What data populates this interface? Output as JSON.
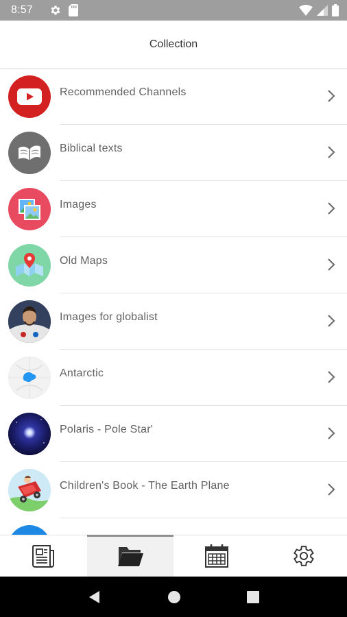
{
  "status_bar": {
    "time": "8:57",
    "left_icons": [
      "gear-icon",
      "sd-card-icon"
    ],
    "right_icons": [
      "wifi-icon",
      "signal-icon",
      "battery-icon"
    ]
  },
  "header": {
    "title": "Collection"
  },
  "collection": {
    "items": [
      {
        "label": "Recommended Channels",
        "icon": "youtube-icon",
        "color": "#d32020"
      },
      {
        "label": "Biblical texts",
        "icon": "book-icon",
        "color": "#6f6f6f"
      },
      {
        "label": "Images",
        "icon": "images-icon",
        "color": "#e84a5f"
      },
      {
        "label": "Old Maps",
        "icon": "map-pin-icon",
        "color": "#7fd6a6"
      },
      {
        "label": "Images for globalist",
        "icon": "astronaut-photo",
        "color": "#2a3b5c"
      },
      {
        "label": "Antarctic",
        "icon": "globe-antarctica-icon",
        "color": "#e9e9e9"
      },
      {
        "label": "Polaris - Pole Star'",
        "icon": "pole-star-photo",
        "color": "#1d1f6e"
      },
      {
        "label": "Children's Book - The Earth Plane",
        "icon": "childrens-book-photo",
        "color": "#c83232"
      }
    ]
  },
  "bottom_nav": {
    "tabs": [
      {
        "icon": "newspaper-icon",
        "active": false
      },
      {
        "icon": "folder-icon",
        "active": true
      },
      {
        "icon": "calendar-icon",
        "active": false
      },
      {
        "icon": "settings-icon",
        "active": false
      }
    ]
  },
  "system_nav": {
    "buttons": [
      "back-button",
      "home-button",
      "recents-button"
    ]
  }
}
